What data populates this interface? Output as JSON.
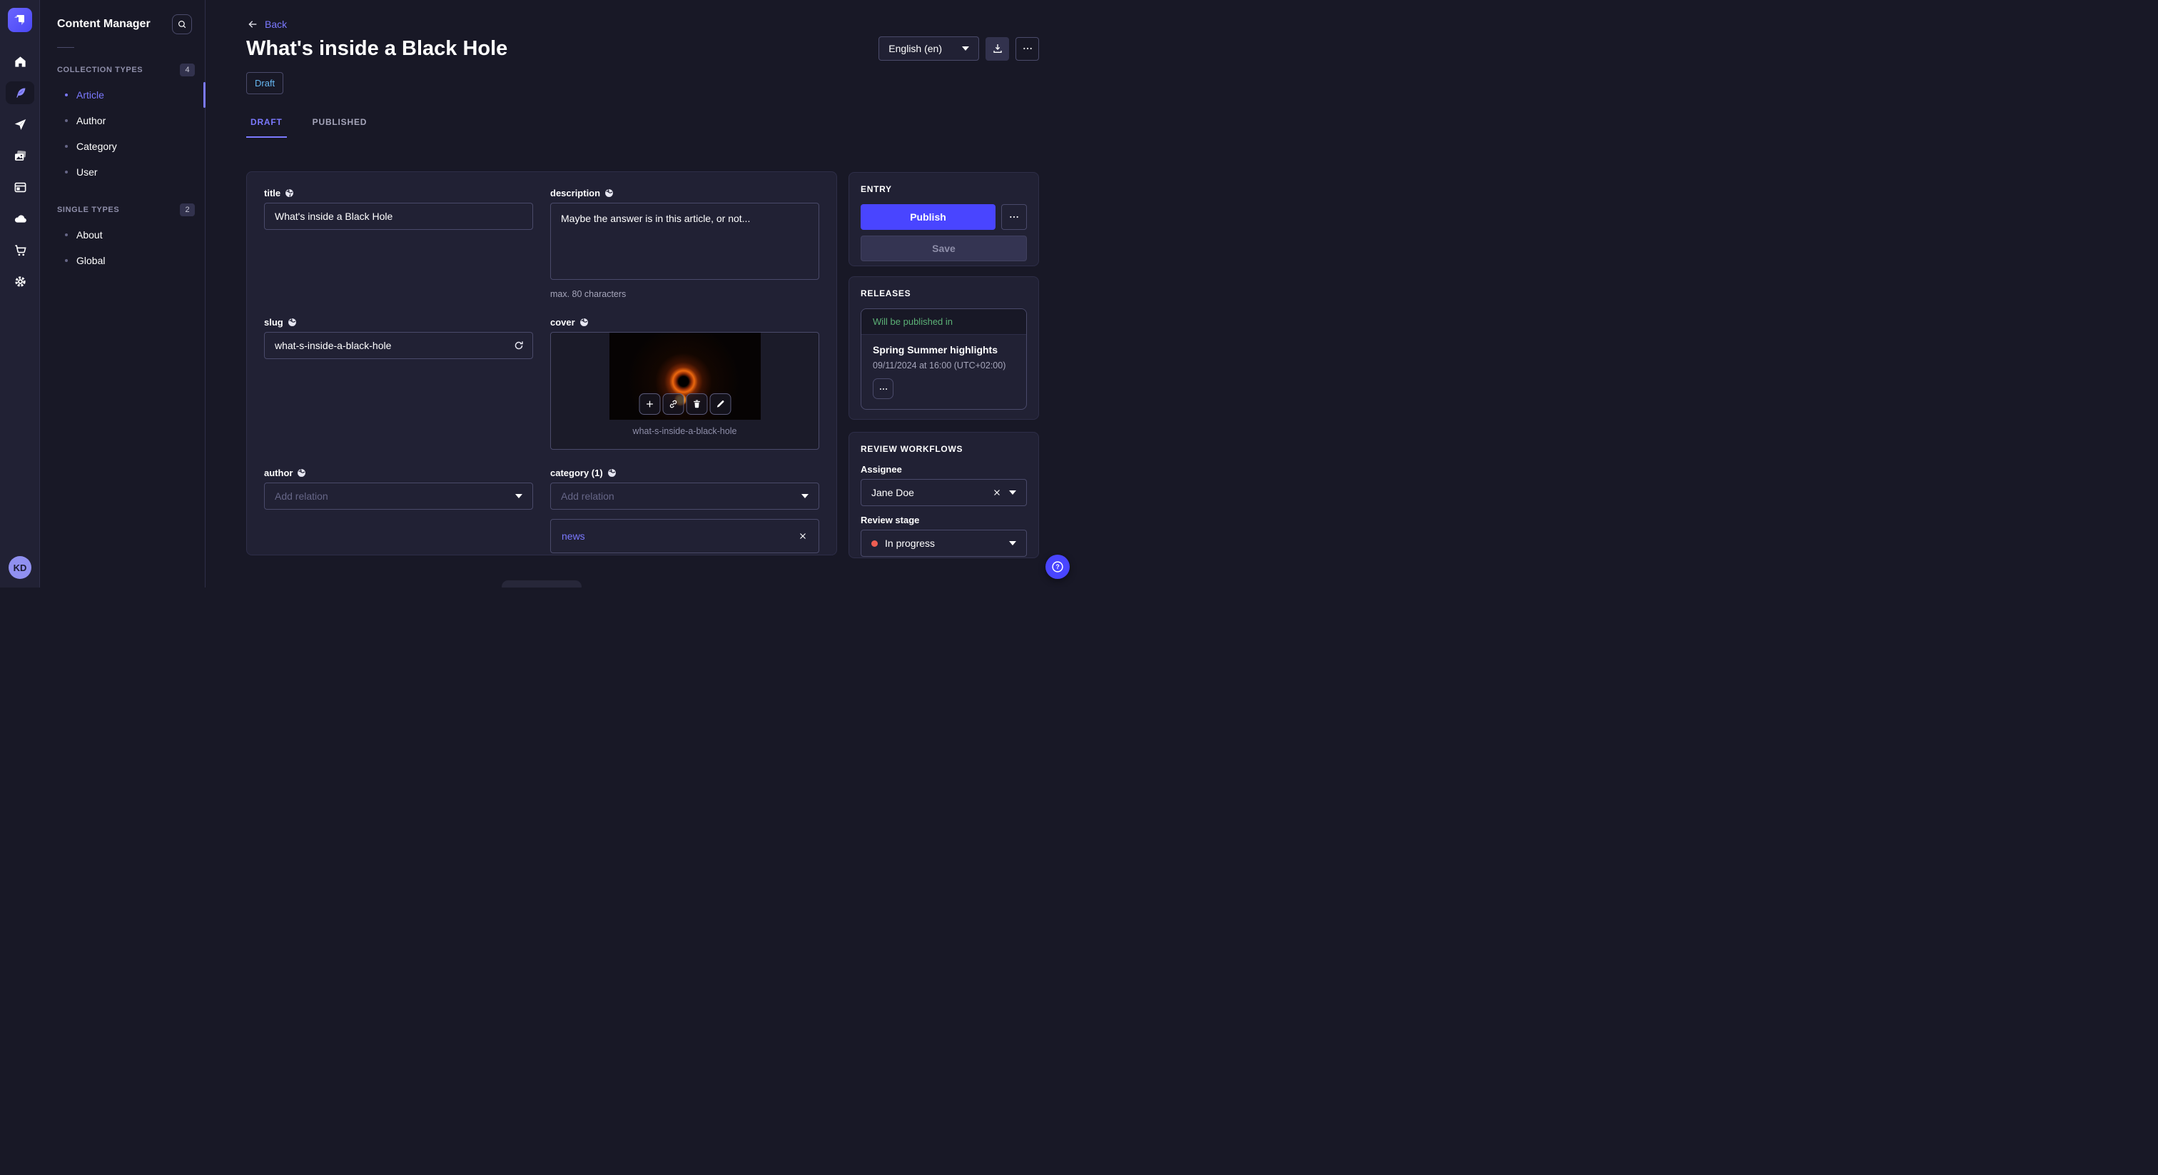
{
  "app": {
    "avatar_initials": "KD"
  },
  "rail": {
    "items": [
      "home",
      "content",
      "deploy",
      "media-library",
      "content-type-builder",
      "cloud",
      "marketplace",
      "settings"
    ],
    "active_item": "content"
  },
  "sidebar": {
    "title": "Content Manager",
    "sections": [
      {
        "label": "COLLECTION TYPES",
        "count": "4",
        "items": [
          {
            "label": "Article",
            "active": true
          },
          {
            "label": "Author"
          },
          {
            "label": "Category"
          },
          {
            "label": "User"
          }
        ]
      },
      {
        "label": "SINGLE TYPES",
        "count": "2",
        "items": [
          {
            "label": "About"
          },
          {
            "label": "Global"
          }
        ]
      }
    ]
  },
  "header": {
    "back_label": "Back",
    "title": "What's inside a Black Hole",
    "status": "Draft",
    "tabs": [
      {
        "label": "DRAFT",
        "active": true
      },
      {
        "label": "PUBLISHED",
        "active": false
      }
    ],
    "locale": "English (en)"
  },
  "form": {
    "title": {
      "label": "title",
      "value": "What's inside a Black Hole"
    },
    "description": {
      "label": "description",
      "value": "Maybe the answer is in this article, or not...",
      "helper": "max. 80 characters"
    },
    "slug": {
      "label": "slug",
      "value": "what-s-inside-a-black-hole"
    },
    "cover": {
      "label": "cover",
      "caption": "what-s-inside-a-black-hole"
    },
    "author": {
      "label": "author",
      "placeholder": "Add relation"
    },
    "category": {
      "label": "category (1)",
      "placeholder": "Add relation",
      "tags": [
        {
          "label": "news"
        }
      ]
    }
  },
  "entry": {
    "heading": "ENTRY",
    "publish_label": "Publish",
    "save_label": "Save"
  },
  "releases": {
    "heading": "RELEASES",
    "status": "Will be published in",
    "name": "Spring Summer highlights",
    "date": "09/11/2024 at 16:00 (UTC+02:00)"
  },
  "review": {
    "heading": "REVIEW WORKFLOWS",
    "assignee_label": "Assignee",
    "assignee": "Jane Doe",
    "stage_label": "Review stage",
    "stage": "In progress"
  },
  "colors": {
    "primary": "#4945ff",
    "primary_light": "#7b79ff",
    "draft_status": "#66b7f1",
    "success": "#5cb176",
    "danger": "#ee5e52"
  }
}
